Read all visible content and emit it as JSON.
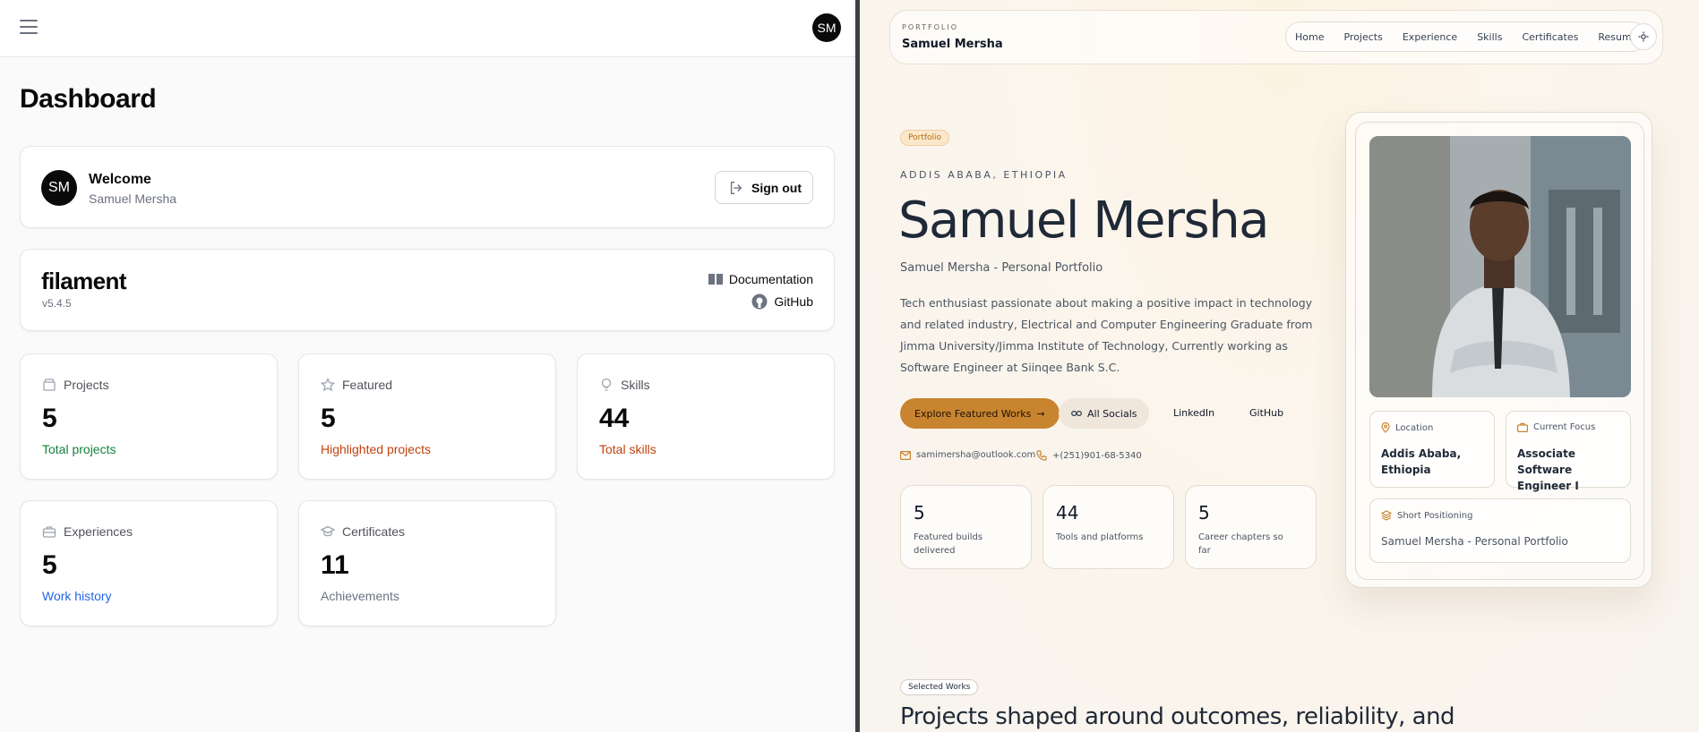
{
  "admin": {
    "avatar_initials": "SM",
    "page_title": "Dashboard",
    "welcome": {
      "initials": "SM",
      "heading": "Welcome",
      "name": "Samuel Mersha",
      "signout_label": "Sign out"
    },
    "filament": {
      "logo": "filament",
      "version": "v5.4.5",
      "docs_label": "Documentation",
      "github_label": "GitHub"
    },
    "stats": [
      {
        "label": "Projects",
        "value": "5",
        "desc": "Total projects",
        "icon": "box-icon"
      },
      {
        "label": "Featured",
        "value": "5",
        "desc": "Highlighted projects",
        "icon": "star-icon"
      },
      {
        "label": "Skills",
        "value": "44",
        "desc": "Total skills",
        "icon": "lightbulb-icon"
      },
      {
        "label": "Experiences",
        "value": "5",
        "desc": "Work history",
        "icon": "briefcase-icon"
      },
      {
        "label": "Certificates",
        "value": "11",
        "desc": "Achievements",
        "icon": "graduation-cap-icon"
      }
    ]
  },
  "portfolio": {
    "nav": {
      "kicker": "PORTFOLIO",
      "brand": "Samuel Mersha",
      "links": [
        "Home",
        "Projects",
        "Experience",
        "Skills",
        "Certificates",
        "Resume"
      ]
    },
    "hero": {
      "badge": "Portfolio",
      "location_kicker": "ADDIS ABABA, ETHIOPIA",
      "name": "Samuel Mersha",
      "subtitle": "Samuel Mersha - Personal Portfolio",
      "bio": "Tech enthusiast passionate about making a positive impact in technology and related industry, Electrical and Computer Engineering Graduate from Jimma University/Jimma Institute of Technology, Currently working as Software Engineer at Siinqee Bank S.C.",
      "explore_label": "Explore Featured Works",
      "socials_label": "All Socials",
      "linkedin_label": "LinkedIn",
      "github_label": "GitHub",
      "email": "samimersha@outlook.com",
      "phone": "+(251)901-68-5340"
    },
    "mini_stats": [
      {
        "value": "5",
        "desc": "Featured builds delivered"
      },
      {
        "value": "44",
        "desc": "Tools and platforms"
      },
      {
        "value": "5",
        "desc": "Career chapters so far"
      }
    ],
    "profile": {
      "location_label": "Location",
      "location_value": "Addis Ababa, Ethiopia",
      "focus_label": "Current Focus",
      "focus_value": "Associate Software Engineer I",
      "positioning_label": "Short Positioning",
      "positioning_value": "Samuel Mersha - Personal Portfolio"
    },
    "selected": {
      "badge": "Selected Works",
      "heading": "Projects shaped around outcomes, reliability, and"
    }
  },
  "colors": {
    "accent": "#c8842f",
    "admin_green": "#15803d",
    "admin_orange": "#c2410c",
    "admin_blue": "#2563eb"
  }
}
